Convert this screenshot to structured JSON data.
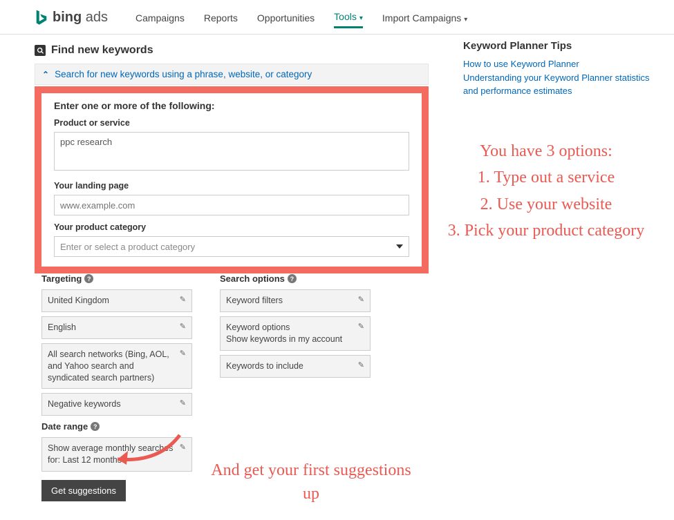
{
  "header": {
    "logo_bing": "bing",
    "logo_ads": "ads",
    "nav": [
      "Campaigns",
      "Reports",
      "Opportunities",
      "Tools",
      "Import Campaigns"
    ]
  },
  "find": {
    "title": "Find new keywords",
    "accordion_label": "Search for new keywords using a phrase, website, or category"
  },
  "form": {
    "enter_title": "Enter one or more of the following:",
    "product_label": "Product or service",
    "product_value": "ppc research",
    "landing_label": "Your landing page",
    "landing_placeholder": "www.example.com",
    "category_label": "Your product category",
    "category_placeholder": "Enter or select a product category"
  },
  "targeting": {
    "head": "Targeting",
    "items": [
      "United Kingdom",
      "English",
      "All search networks (Bing, AOL, and Yahoo search and syndicated search partners)",
      "Negative keywords"
    ]
  },
  "searchoptions": {
    "head": "Search options",
    "items": [
      "Keyword filters",
      "Keyword options\nShow keywords in my account",
      "Keywords to include"
    ]
  },
  "daterange": {
    "head": "Date range",
    "item": "Show average monthly searches for: Last 12 months"
  },
  "button": {
    "get": "Get suggestions"
  },
  "tips": {
    "title": "Keyword Planner Tips",
    "links": [
      "How to use Keyword Planner",
      "Understanding your Keyword Planner statistics and performance estimates"
    ]
  },
  "annotations": {
    "right": "You have 3 options:\n1. Type out a service\n2. Use your website\n3. Pick your product category",
    "bottom": "And get your first suggestions up"
  }
}
